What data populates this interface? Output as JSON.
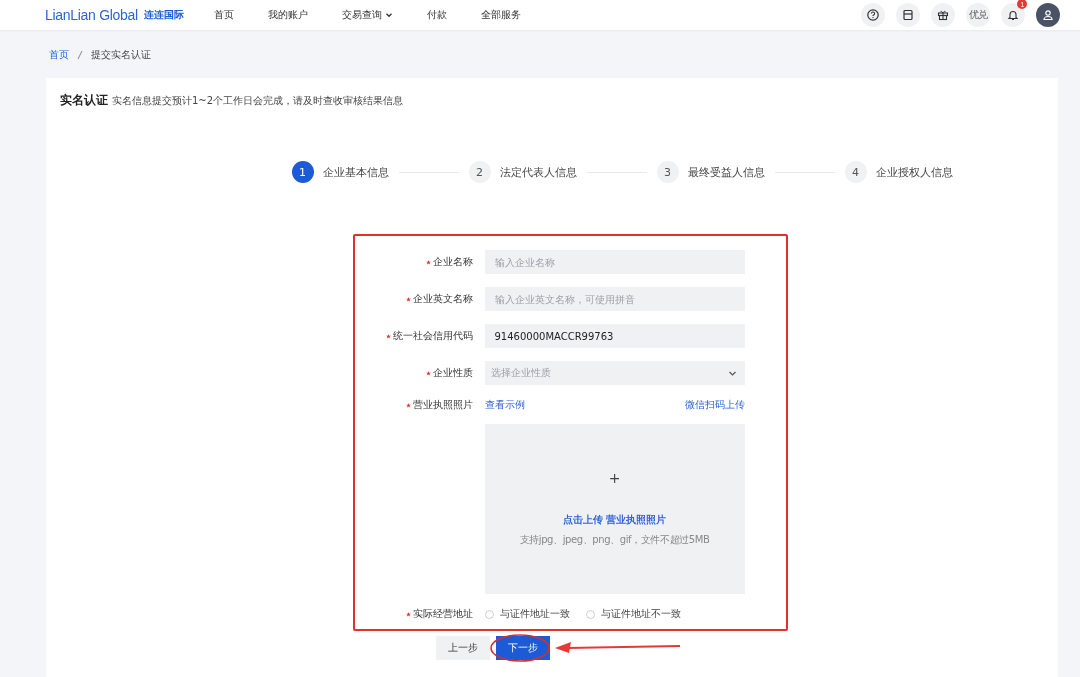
{
  "header": {
    "logo": "LianLian Global",
    "logo_cn": "连连国际",
    "nav": [
      {
        "label": "首页",
        "dropdown": false
      },
      {
        "label": "我的账户",
        "dropdown": false
      },
      {
        "label": "交易查询",
        "dropdown": true
      },
      {
        "label": "付款",
        "dropdown": false
      },
      {
        "label": "全部服务",
        "dropdown": false
      }
    ],
    "actions": [
      {
        "kind": "help"
      },
      {
        "kind": "calendar"
      },
      {
        "kind": "gift"
      },
      {
        "kind": "text",
        "label": "优兑"
      },
      {
        "kind": "bell",
        "badge": "1"
      },
      {
        "kind": "avatar"
      }
    ]
  },
  "breadcrumb": [
    {
      "label": "首页",
      "link": true
    },
    {
      "label": "提交实名认证",
      "link": false
    }
  ],
  "page": {
    "title": "实名认证",
    "subtitle": "实名信息提交预计1~2个工作日会完成，请及时查收审核结果信息"
  },
  "steps": [
    {
      "number": "1",
      "label": "企业基本信息",
      "selected": true
    },
    {
      "number": "2",
      "label": "法定代表人信息",
      "selected": false
    },
    {
      "number": "3",
      "label": "最终受益人信息",
      "selected": false
    },
    {
      "number": "4",
      "label": "企业授权人信息",
      "selected": false
    }
  ],
  "form": {
    "fields": [
      {
        "kind": "text",
        "label": "企业名称",
        "required": true,
        "placeholder": "输入企业名称"
      },
      {
        "kind": "text",
        "label": "企业英文名称",
        "required": true,
        "placeholder": "输入企业英文名称，可使用拼音"
      },
      {
        "kind": "text",
        "label": "统一社会信用代码",
        "required": true,
        "value": "91460000MACCR99763"
      },
      {
        "kind": "select",
        "label": "企业性质",
        "required": true,
        "placeholder": "选择企业性质"
      },
      {
        "kind": "upload",
        "label": "营业执照照片",
        "required": true,
        "link": "查看示例",
        "alt_link": "微信扫码上传",
        "plus": "+",
        "action": "点击上传 营业执照照片",
        "hint": "支持jpg、jpeg、png、gif，文件不超过5MB"
      },
      {
        "kind": "radio",
        "label": "实际经营地址",
        "required": true,
        "options": [
          {
            "label": "与证件地址一致",
            "selected": false
          },
          {
            "label": "与证件地址不一致",
            "selected": false
          }
        ]
      }
    ]
  },
  "buttons": [
    {
      "label": "上一步",
      "primary": false
    },
    {
      "label": "下一步",
      "primary": true
    }
  ]
}
